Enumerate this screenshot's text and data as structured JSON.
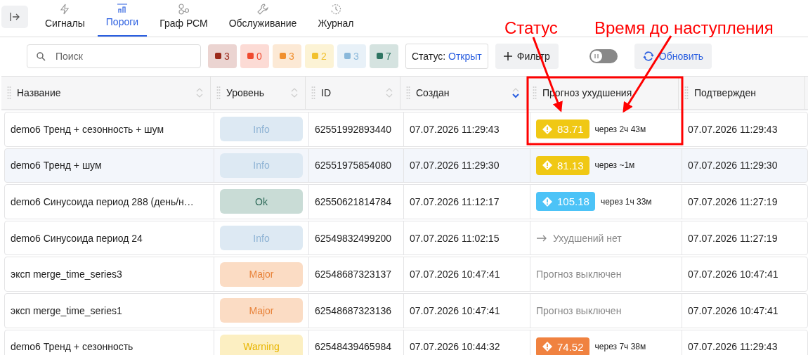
{
  "tabs": [
    {
      "label": "Сигналы",
      "selected": false
    },
    {
      "label": "Пороги",
      "selected": true
    },
    {
      "label": "Граф РСМ",
      "selected": false
    },
    {
      "label": "Обслуживание",
      "selected": false
    },
    {
      "label": "Журнал",
      "selected": false
    }
  ],
  "toolbar": {
    "search": {
      "placeholder": "Поиск"
    },
    "counters": [
      {
        "count": "3",
        "color": "#9b2a1b"
      },
      {
        "count": "0",
        "color": "#ef4a2f"
      },
      {
        "count": "3",
        "color": "#f0902f"
      },
      {
        "count": "2",
        "color": "#f2c12e"
      },
      {
        "count": "3",
        "color": "#8ab8da"
      },
      {
        "count": "7",
        "color": "#2f7562"
      }
    ],
    "status_filter": {
      "label": "Статус:",
      "value": "Открыт"
    },
    "filter_button": "Фильтр",
    "pause_toggle": {
      "on": false
    },
    "refresh_button": "Обновить"
  },
  "table": {
    "columns": [
      {
        "label": "Название",
        "sortable": true,
        "sorted_descending": false
      },
      {
        "label": "Уровень",
        "sortable": true,
        "sorted_descending": false
      },
      {
        "label": "ID",
        "sortable": true,
        "sorted_descending": false
      },
      {
        "label": "Создан",
        "sortable": true,
        "sorted_descending": true
      },
      {
        "label": "Прогноз ухудшения",
        "sortable": false
      },
      {
        "label": "Подтвержден",
        "sortable": false
      }
    ],
    "rows": [
      {
        "selected": false,
        "name": "demo6 Тренд + сезонность + шум",
        "level": {
          "kind": "info",
          "label": "Info"
        },
        "id": "62551992893440",
        "created": "07.07.2026 11:29:43",
        "forecast": {
          "kind": "badge",
          "value": "83.71",
          "color": "#f0c814",
          "eta": "через 2ч 43м"
        },
        "confirmed": "07.07.2026 11:29:43"
      },
      {
        "selected": true,
        "name": "demo6 Тренд + шум",
        "level": {
          "kind": "info",
          "label": "Info"
        },
        "id": "62551975854080",
        "created": "07.07.2026 11:29:30",
        "forecast": {
          "kind": "badge",
          "value": "81.13",
          "color": "#f0c814",
          "eta": "через ~1м"
        },
        "confirmed": "07.07.2026 11:29:30"
      },
      {
        "selected": false,
        "name": "demo6 Синусоида период 288 (день/н…",
        "level": {
          "kind": "ok",
          "label": "Ok"
        },
        "id": "62550621814784",
        "created": "07.07.2026 11:12:17",
        "forecast": {
          "kind": "badge",
          "value": "105.18",
          "color": "#4cc3f7",
          "eta": "через 1ч 33м"
        },
        "confirmed": "07.07.2026 11:27:19"
      },
      {
        "selected": false,
        "name": "demo6 Синусоида период 24",
        "level": {
          "kind": "info",
          "label": "Info"
        },
        "id": "62549832499200",
        "created": "07.07.2026 11:02:15",
        "forecast": {
          "kind": "none",
          "text": "Ухудшений нет"
        },
        "confirmed": "07.07.2026 11:27:19"
      },
      {
        "selected": false,
        "name": "эксп merge_time_series3",
        "level": {
          "kind": "major",
          "label": "Major"
        },
        "id": "62548687323137",
        "created": "07.07.2026 10:47:41",
        "forecast": {
          "kind": "off",
          "text": "Прогноз выключен"
        },
        "confirmed": "07.07.2026 10:47:41"
      },
      {
        "selected": false,
        "name": "эксп merge_time_series1",
        "level": {
          "kind": "major",
          "label": "Major"
        },
        "id": "62548687323136",
        "created": "07.07.2026 10:47:41",
        "forecast": {
          "kind": "off",
          "text": "Прогноз выключен"
        },
        "confirmed": "07.07.2026 10:47:41"
      },
      {
        "selected": false,
        "name": "demo6 Тренд + сезонность",
        "level": {
          "kind": "warning",
          "label": "Warning"
        },
        "id": "62548439465984",
        "created": "07.07.2026 10:44:32",
        "forecast": {
          "kind": "badge",
          "value": "74.52",
          "color": "#f08240",
          "eta": "через 7ч 38м"
        },
        "confirmed": "07.07.2026 11:29:43"
      }
    ]
  },
  "annotations": [
    {
      "text": "Статус"
    },
    {
      "text": "Время до наступления"
    }
  ]
}
